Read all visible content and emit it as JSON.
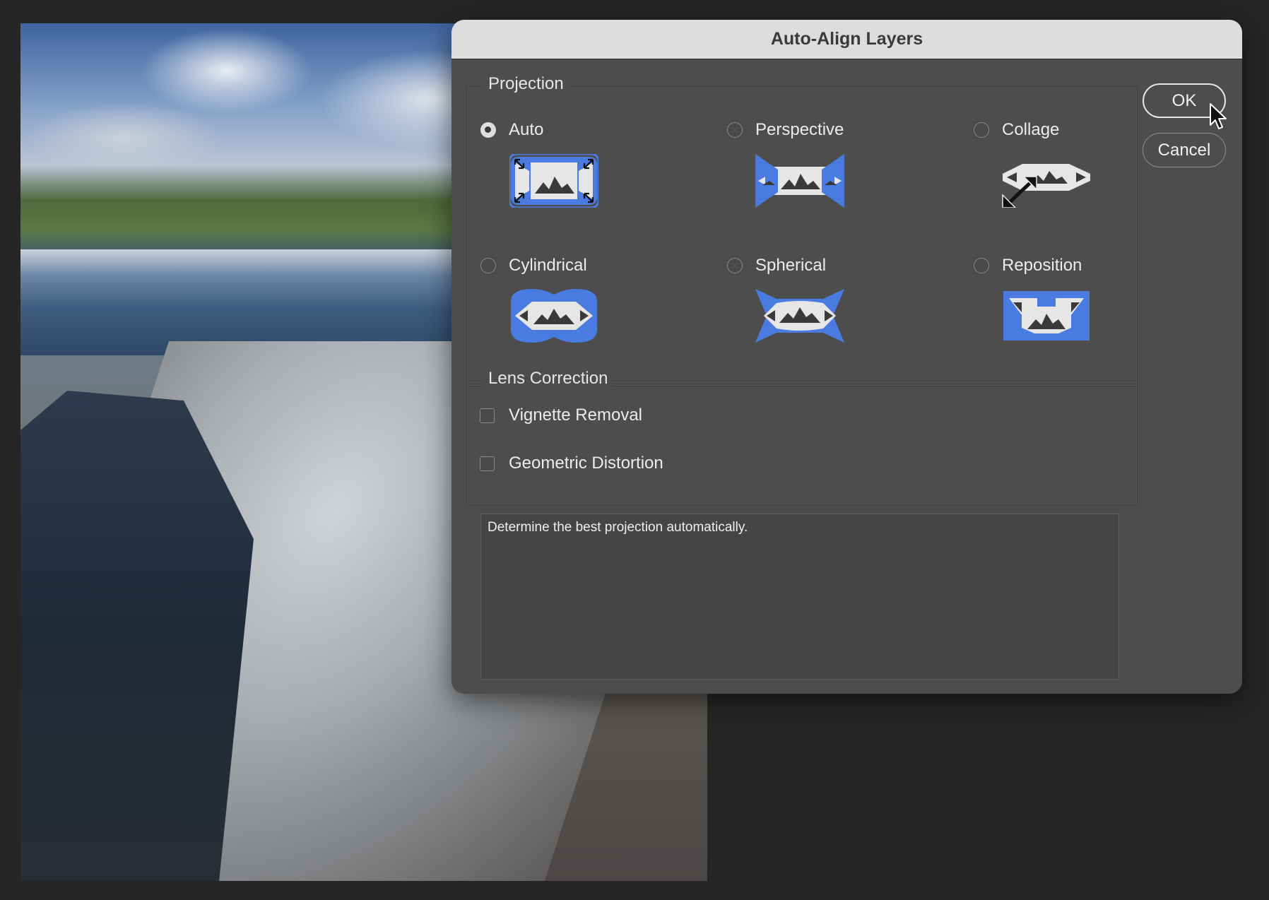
{
  "dialog": {
    "title": "Auto-Align Layers",
    "buttons": {
      "ok": "OK",
      "cancel": "Cancel"
    }
  },
  "projection": {
    "legend": "Projection",
    "selected": "Auto",
    "options": [
      {
        "label": "Auto",
        "icon": "auto-projection-icon",
        "checked": true
      },
      {
        "label": "Perspective",
        "icon": "perspective-projection-icon",
        "checked": false
      },
      {
        "label": "Collage",
        "icon": "collage-projection-icon",
        "checked": false
      },
      {
        "label": "Cylindrical",
        "icon": "cylindrical-projection-icon",
        "checked": false
      },
      {
        "label": "Spherical",
        "icon": "spherical-projection-icon",
        "checked": false
      },
      {
        "label": "Reposition",
        "icon": "reposition-projection-icon",
        "checked": false
      }
    ]
  },
  "lens_correction": {
    "legend": "Lens Correction",
    "options": [
      {
        "label": "Vignette Removal",
        "checked": false
      },
      {
        "label": "Geometric Distortion",
        "checked": false
      }
    ]
  },
  "description": "Determine the best projection automatically.",
  "colors": {
    "accent": "#4a7be0",
    "dialog_bg": "#4d4d4d",
    "titlebar_bg": "#dedcdc"
  }
}
